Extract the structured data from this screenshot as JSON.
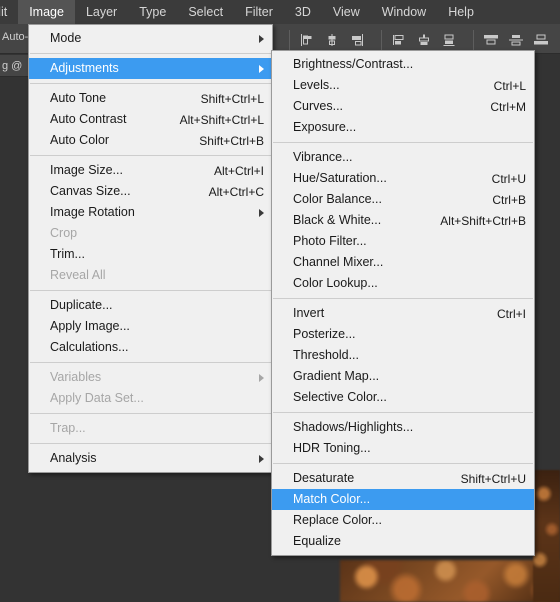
{
  "app": {
    "accent_color": "#3c9bf0",
    "menu_bg": "#f0f0f0",
    "chrome_bg": "#333333"
  },
  "menubar": {
    "items": [
      {
        "label": "dit",
        "state": "clipped"
      },
      {
        "label": "Image",
        "state": "active"
      },
      {
        "label": "Layer",
        "state": "normal"
      },
      {
        "label": "Type",
        "state": "normal"
      },
      {
        "label": "Select",
        "state": "normal"
      },
      {
        "label": "Filter",
        "state": "normal"
      },
      {
        "label": "3D",
        "state": "normal"
      },
      {
        "label": "View",
        "state": "normal"
      },
      {
        "label": "Window",
        "state": "normal"
      },
      {
        "label": "Help",
        "state": "normal"
      }
    ]
  },
  "options_bar": {
    "auto_label": "Auto-",
    "align_icons": [
      "align-left-edges-icon",
      "align-horizontal-centers-icon",
      "align-right-edges-icon",
      "align-top-edges-icon",
      "align-vertical-centers-icon",
      "align-bottom-edges-icon",
      "distribute-top-edges-icon",
      "distribute-vertical-centers-icon",
      "distribute-bottom-edges-icon"
    ]
  },
  "document_tab": {
    "label": "g @"
  },
  "image_menu": {
    "title": "Image",
    "items": [
      {
        "type": "item",
        "label": "Mode",
        "accel": "",
        "submenu": true,
        "disabled": false,
        "highlight": false
      },
      {
        "type": "separator"
      },
      {
        "type": "item",
        "label": "Adjustments",
        "accel": "",
        "submenu": true,
        "disabled": false,
        "highlight": true
      },
      {
        "type": "separator"
      },
      {
        "type": "item",
        "label": "Auto Tone",
        "accel": "Shift+Ctrl+L",
        "submenu": false,
        "disabled": false,
        "highlight": false
      },
      {
        "type": "item",
        "label": "Auto Contrast",
        "accel": "Alt+Shift+Ctrl+L",
        "submenu": false,
        "disabled": false,
        "highlight": false
      },
      {
        "type": "item",
        "label": "Auto Color",
        "accel": "Shift+Ctrl+B",
        "submenu": false,
        "disabled": false,
        "highlight": false
      },
      {
        "type": "separator"
      },
      {
        "type": "item",
        "label": "Image Size...",
        "accel": "Alt+Ctrl+I",
        "submenu": false,
        "disabled": false,
        "highlight": false
      },
      {
        "type": "item",
        "label": "Canvas Size...",
        "accel": "Alt+Ctrl+C",
        "submenu": false,
        "disabled": false,
        "highlight": false
      },
      {
        "type": "item",
        "label": "Image Rotation",
        "accel": "",
        "submenu": true,
        "disabled": false,
        "highlight": false
      },
      {
        "type": "item",
        "label": "Crop",
        "accel": "",
        "submenu": false,
        "disabled": true,
        "highlight": false
      },
      {
        "type": "item",
        "label": "Trim...",
        "accel": "",
        "submenu": false,
        "disabled": false,
        "highlight": false
      },
      {
        "type": "item",
        "label": "Reveal All",
        "accel": "",
        "submenu": false,
        "disabled": true,
        "highlight": false
      },
      {
        "type": "separator"
      },
      {
        "type": "item",
        "label": "Duplicate...",
        "accel": "",
        "submenu": false,
        "disabled": false,
        "highlight": false
      },
      {
        "type": "item",
        "label": "Apply Image...",
        "accel": "",
        "submenu": false,
        "disabled": false,
        "highlight": false
      },
      {
        "type": "item",
        "label": "Calculations...",
        "accel": "",
        "submenu": false,
        "disabled": false,
        "highlight": false
      },
      {
        "type": "separator"
      },
      {
        "type": "item",
        "label": "Variables",
        "accel": "",
        "submenu": true,
        "disabled": true,
        "highlight": false
      },
      {
        "type": "item",
        "label": "Apply Data Set...",
        "accel": "",
        "submenu": false,
        "disabled": true,
        "highlight": false
      },
      {
        "type": "separator"
      },
      {
        "type": "item",
        "label": "Trap...",
        "accel": "",
        "submenu": false,
        "disabled": true,
        "highlight": false
      },
      {
        "type": "separator"
      },
      {
        "type": "item",
        "label": "Analysis",
        "accel": "",
        "submenu": true,
        "disabled": false,
        "highlight": false
      }
    ]
  },
  "adjustments_menu": {
    "title": "Adjustments",
    "items": [
      {
        "type": "item",
        "label": "Brightness/Contrast...",
        "accel": "",
        "submenu": false,
        "disabled": false,
        "highlight": false
      },
      {
        "type": "item",
        "label": "Levels...",
        "accel": "Ctrl+L",
        "submenu": false,
        "disabled": false,
        "highlight": false
      },
      {
        "type": "item",
        "label": "Curves...",
        "accel": "Ctrl+M",
        "submenu": false,
        "disabled": false,
        "highlight": false
      },
      {
        "type": "item",
        "label": "Exposure...",
        "accel": "",
        "submenu": false,
        "disabled": false,
        "highlight": false
      },
      {
        "type": "separator"
      },
      {
        "type": "item",
        "label": "Vibrance...",
        "accel": "",
        "submenu": false,
        "disabled": false,
        "highlight": false
      },
      {
        "type": "item",
        "label": "Hue/Saturation...",
        "accel": "Ctrl+U",
        "submenu": false,
        "disabled": false,
        "highlight": false
      },
      {
        "type": "item",
        "label": "Color Balance...",
        "accel": "Ctrl+B",
        "submenu": false,
        "disabled": false,
        "highlight": false
      },
      {
        "type": "item",
        "label": "Black & White...",
        "accel": "Alt+Shift+Ctrl+B",
        "submenu": false,
        "disabled": false,
        "highlight": false
      },
      {
        "type": "item",
        "label": "Photo Filter...",
        "accel": "",
        "submenu": false,
        "disabled": false,
        "highlight": false
      },
      {
        "type": "item",
        "label": "Channel Mixer...",
        "accel": "",
        "submenu": false,
        "disabled": false,
        "highlight": false
      },
      {
        "type": "item",
        "label": "Color Lookup...",
        "accel": "",
        "submenu": false,
        "disabled": false,
        "highlight": false
      },
      {
        "type": "separator"
      },
      {
        "type": "item",
        "label": "Invert",
        "accel": "Ctrl+I",
        "submenu": false,
        "disabled": false,
        "highlight": false
      },
      {
        "type": "item",
        "label": "Posterize...",
        "accel": "",
        "submenu": false,
        "disabled": false,
        "highlight": false
      },
      {
        "type": "item",
        "label": "Threshold...",
        "accel": "",
        "submenu": false,
        "disabled": false,
        "highlight": false
      },
      {
        "type": "item",
        "label": "Gradient Map...",
        "accel": "",
        "submenu": false,
        "disabled": false,
        "highlight": false
      },
      {
        "type": "item",
        "label": "Selective Color...",
        "accel": "",
        "submenu": false,
        "disabled": false,
        "highlight": false
      },
      {
        "type": "separator"
      },
      {
        "type": "item",
        "label": "Shadows/Highlights...",
        "accel": "",
        "submenu": false,
        "disabled": false,
        "highlight": false
      },
      {
        "type": "item",
        "label": "HDR Toning...",
        "accel": "",
        "submenu": false,
        "disabled": false,
        "highlight": false
      },
      {
        "type": "separator"
      },
      {
        "type": "item",
        "label": "Desaturate",
        "accel": "Shift+Ctrl+U",
        "submenu": false,
        "disabled": false,
        "highlight": false
      },
      {
        "type": "item",
        "label": "Match Color...",
        "accel": "",
        "submenu": false,
        "disabled": false,
        "highlight": true
      },
      {
        "type": "item",
        "label": "Replace Color...",
        "accel": "",
        "submenu": false,
        "disabled": false,
        "highlight": false
      },
      {
        "type": "item",
        "label": "Equalize",
        "accel": "",
        "submenu": false,
        "disabled": false,
        "highlight": false
      }
    ]
  }
}
